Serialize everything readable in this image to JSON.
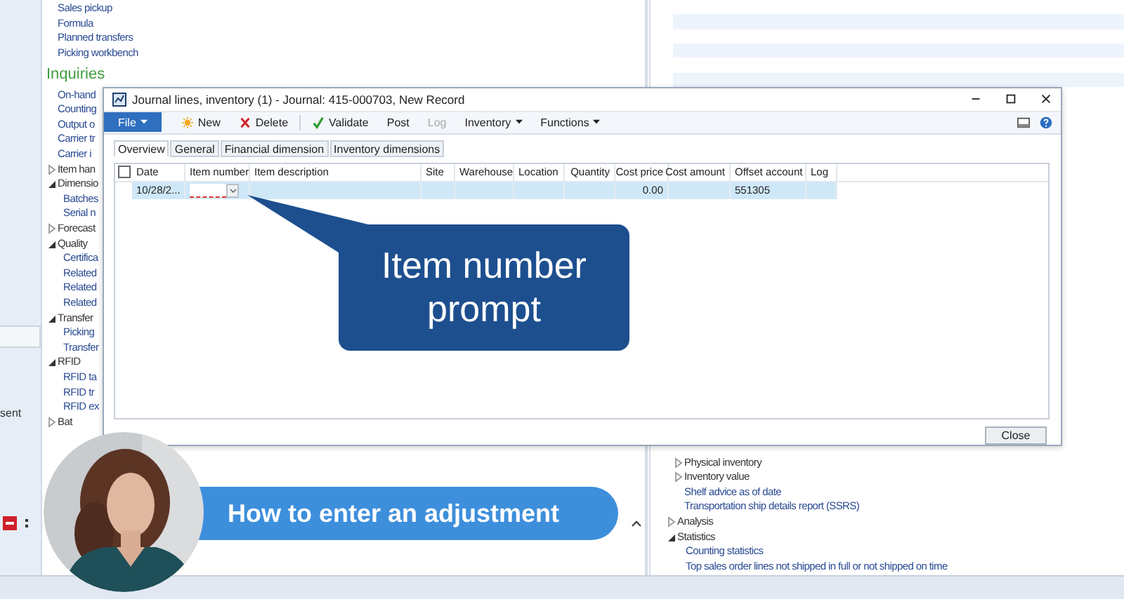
{
  "app": {
    "side_panel": {
      "text": "sent"
    },
    "tree_top": [
      {
        "kind": "link",
        "label": "Sales pickup"
      },
      {
        "kind": "link",
        "label": "Formula"
      },
      {
        "kind": "link",
        "label": "Planned transfers"
      },
      {
        "kind": "link",
        "label": "Picking workbench"
      }
    ],
    "inquiries": {
      "title": "Inquiries",
      "items": [
        {
          "kind": "link",
          "label": "On-hand"
        },
        {
          "kind": "link",
          "label": "Counting"
        },
        {
          "kind": "link",
          "label": "Output o"
        },
        {
          "kind": "link",
          "label": "Carrier tr"
        },
        {
          "kind": "link",
          "label": "Carrier i"
        },
        {
          "kind": "group",
          "label": "Item han",
          "expanded": false
        },
        {
          "kind": "group",
          "label": "Dimensio",
          "expanded": true,
          "children": [
            {
              "kind": "link",
              "label": "Batches"
            },
            {
              "kind": "link",
              "label": "Serial n"
            }
          ]
        },
        {
          "kind": "group",
          "label": "Forecast",
          "expanded": false
        },
        {
          "kind": "group",
          "label": "Quality",
          "expanded": true,
          "children": [
            {
              "kind": "link",
              "label": "Certifica"
            },
            {
              "kind": "link",
              "label": "Related"
            },
            {
              "kind": "link",
              "label": "Related"
            },
            {
              "kind": "link",
              "label": "Related"
            }
          ]
        },
        {
          "kind": "group",
          "label": "Transfer",
          "expanded": true,
          "children": [
            {
              "kind": "link",
              "label": "Picking"
            },
            {
              "kind": "link",
              "label": "Transfer"
            }
          ]
        },
        {
          "kind": "group",
          "label": "RFID",
          "expanded": true,
          "children": [
            {
              "kind": "link",
              "label": "RFID ta"
            },
            {
              "kind": "link",
              "label": "RFID tr"
            },
            {
              "kind": "link",
              "label": "RFID ex"
            }
          ]
        },
        {
          "kind": "group",
          "label": "Bat",
          "expanded": false
        }
      ]
    },
    "tree_lower_continued": [
      {
        "kind": "group",
        "label": "Physical inventory",
        "expanded": false
      },
      {
        "kind": "group",
        "label": "Inventory value",
        "expanded": false
      },
      {
        "kind": "link",
        "label": "Shelf advice as of date"
      },
      {
        "kind": "link",
        "label": "Transportation ship details report (SSRS)"
      }
    ],
    "tree_lower": [
      {
        "kind": "group",
        "label": "Analysis",
        "expanded": false
      },
      {
        "kind": "group",
        "label": "Statistics",
        "expanded": true,
        "children": [
          {
            "kind": "link",
            "label": "Counting statistics"
          },
          {
            "kind": "link",
            "label": "Top sales order lines not shipped in full or not shipped on time"
          }
        ]
      }
    ]
  },
  "dialog": {
    "title": "Journal lines, inventory (1) - Journal: 415-000703, New Record",
    "toolbar": [
      {
        "label": "File",
        "kind": "file",
        "disabled": false
      },
      {
        "label": "New",
        "kind": "new",
        "disabled": false
      },
      {
        "label": "Delete",
        "kind": "delete",
        "disabled": false
      },
      {
        "label": "Validate",
        "kind": "validate",
        "disabled": false
      },
      {
        "label": "Post",
        "kind": "command",
        "disabled": false
      },
      {
        "label": "Log",
        "kind": "command",
        "disabled": true
      },
      {
        "label": "Inventory",
        "kind": "menu",
        "disabled": false
      },
      {
        "label": "Functions",
        "kind": "menu",
        "disabled": false
      }
    ],
    "select_all_checked": false,
    "tabs": [
      {
        "label": "Overview",
        "selected": true
      },
      {
        "label": "General",
        "selected": false
      },
      {
        "label": "Financial dimension",
        "selected": false
      },
      {
        "label": "Inventory dimensions",
        "selected": false
      }
    ],
    "columns": [
      {
        "label": "Date",
        "numeric": false
      },
      {
        "label": "Item number",
        "numeric": false
      },
      {
        "label": "Item description",
        "numeric": false
      },
      {
        "label": "Site",
        "numeric": false
      },
      {
        "label": "Warehouse",
        "numeric": false
      },
      {
        "label": "Location",
        "numeric": false
      },
      {
        "label": "Quantity",
        "numeric": true
      },
      {
        "label": "Cost price",
        "numeric": true
      },
      {
        "label": "Cost amount",
        "numeric": true
      },
      {
        "label": "Offset account",
        "numeric": false
      },
      {
        "label": "Log",
        "numeric": false
      }
    ],
    "rows": [
      {
        "selected": true,
        "cells": [
          {
            "kind": "text",
            "text": "10/28/2..."
          },
          {
            "kind": "lookup"
          },
          {
            "kind": "text"
          },
          {
            "kind": "text"
          },
          {
            "kind": "text"
          },
          {
            "kind": "text"
          },
          {
            "kind": "text"
          },
          {
            "kind": "text",
            "text": "0.00"
          },
          {
            "kind": "text"
          },
          {
            "kind": "text",
            "text": "551305"
          },
          {
            "kind": "text"
          }
        ]
      }
    ],
    "close_button": "Close"
  },
  "callout": {
    "text": "Item number prompt"
  },
  "video": {
    "banner": "How to enter an adjustment"
  }
}
